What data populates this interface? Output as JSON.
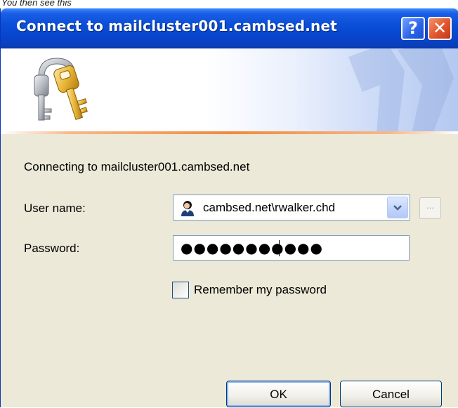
{
  "caption": "You then see this",
  "dialog": {
    "title": "Connect to mailcluster001.cambsed.net",
    "help_label": "?",
    "close_label": "✕",
    "connecting_text": "Connecting to mailcluster001.cambsed.net",
    "username_label": "User name:",
    "username_value": "cambsed.net\\rwalker.chd",
    "browse_label": "...",
    "password_label": "Password:",
    "password_value": "●●●●●●●●●●●",
    "remember_label": "Remember my password",
    "remember_checked": false,
    "ok_label": "OK",
    "cancel_label": "Cancel"
  },
  "icons": {
    "banner": "keys-icon",
    "user": "user-account-icon",
    "dropdown": "chevron-down-icon"
  },
  "colors": {
    "titlebar": "#0a4fd8",
    "dialog_bg": "#ece9d8",
    "close_red": "#e0552d",
    "accent_orange": "#f08a3c"
  }
}
